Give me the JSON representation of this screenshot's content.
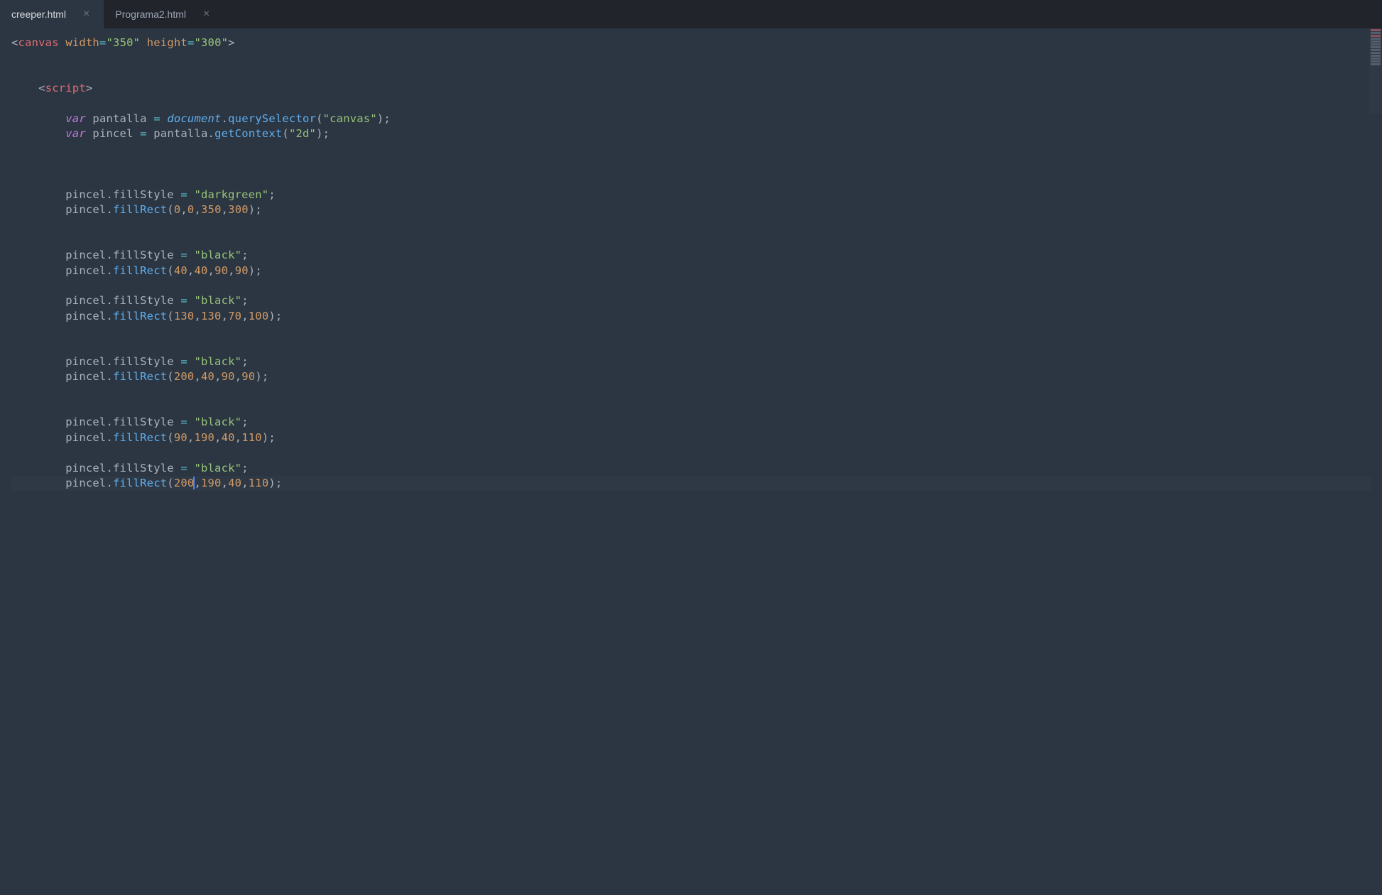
{
  "tabs": [
    {
      "label": "creeper.html",
      "active": true
    },
    {
      "label": "Programa2.html",
      "active": false
    }
  ],
  "code": {
    "lines": [
      {
        "type": "html",
        "indent": 0,
        "tokens": [
          {
            "t": "tag-bracket",
            "v": "<"
          },
          {
            "t": "tag-name",
            "v": "canvas"
          },
          {
            "t": "punct",
            "v": " "
          },
          {
            "t": "attr-name",
            "v": "width"
          },
          {
            "t": "operator",
            "v": "="
          },
          {
            "t": "attr-value",
            "v": "\"350\""
          },
          {
            "t": "punct",
            "v": " "
          },
          {
            "t": "attr-name",
            "v": "height"
          },
          {
            "t": "operator",
            "v": "="
          },
          {
            "t": "attr-value",
            "v": "\"300\""
          },
          {
            "t": "tag-bracket",
            "v": ">"
          }
        ]
      },
      {
        "type": "blank",
        "indent": 1
      },
      {
        "type": "blank",
        "indent": 1
      },
      {
        "type": "html",
        "indent": 1,
        "tokens": [
          {
            "t": "tag-bracket",
            "v": "<"
          },
          {
            "t": "tag-name",
            "v": "script"
          },
          {
            "t": "tag-bracket",
            "v": ">"
          }
        ]
      },
      {
        "type": "blank",
        "indent": 2
      },
      {
        "type": "js",
        "indent": 2,
        "tokens": [
          {
            "t": "keyword",
            "v": "var"
          },
          {
            "t": "punct",
            "v": " "
          },
          {
            "t": "variable",
            "v": "pantalla"
          },
          {
            "t": "punct",
            "v": " "
          },
          {
            "t": "operator",
            "v": "="
          },
          {
            "t": "punct",
            "v": " "
          },
          {
            "t": "builtin",
            "v": "document"
          },
          {
            "t": "dot",
            "v": "."
          },
          {
            "t": "method",
            "v": "querySelector"
          },
          {
            "t": "paren",
            "v": "("
          },
          {
            "t": "string",
            "v": "\"canvas\""
          },
          {
            "t": "paren",
            "v": ")"
          },
          {
            "t": "semi",
            "v": ";"
          }
        ]
      },
      {
        "type": "js",
        "indent": 2,
        "tokens": [
          {
            "t": "keyword",
            "v": "var"
          },
          {
            "t": "punct",
            "v": " "
          },
          {
            "t": "variable",
            "v": "pincel"
          },
          {
            "t": "punct",
            "v": " "
          },
          {
            "t": "operator",
            "v": "="
          },
          {
            "t": "punct",
            "v": " "
          },
          {
            "t": "variable",
            "v": "pantalla"
          },
          {
            "t": "dot",
            "v": "."
          },
          {
            "t": "method",
            "v": "getContext"
          },
          {
            "t": "paren",
            "v": "("
          },
          {
            "t": "string",
            "v": "\"2d\""
          },
          {
            "t": "paren",
            "v": ")"
          },
          {
            "t": "semi",
            "v": ";"
          }
        ]
      },
      {
        "type": "blank",
        "indent": 2
      },
      {
        "type": "blank",
        "indent": 2
      },
      {
        "type": "blank",
        "indent": 2
      },
      {
        "type": "js",
        "indent": 2,
        "tokens": [
          {
            "t": "variable",
            "v": "pincel"
          },
          {
            "t": "dot",
            "v": "."
          },
          {
            "t": "variable",
            "v": "fillStyle"
          },
          {
            "t": "punct",
            "v": " "
          },
          {
            "t": "operator",
            "v": "="
          },
          {
            "t": "punct",
            "v": " "
          },
          {
            "t": "string",
            "v": "\"darkgreen\""
          },
          {
            "t": "semi",
            "v": ";"
          }
        ]
      },
      {
        "type": "js",
        "indent": 2,
        "tokens": [
          {
            "t": "variable",
            "v": "pincel"
          },
          {
            "t": "dot",
            "v": "."
          },
          {
            "t": "method",
            "v": "fillRect"
          },
          {
            "t": "paren",
            "v": "("
          },
          {
            "t": "number",
            "v": "0"
          },
          {
            "t": "punct",
            "v": ","
          },
          {
            "t": "number",
            "v": "0"
          },
          {
            "t": "punct",
            "v": ","
          },
          {
            "t": "number",
            "v": "350"
          },
          {
            "t": "punct",
            "v": ","
          },
          {
            "t": "number",
            "v": "300"
          },
          {
            "t": "paren",
            "v": ")"
          },
          {
            "t": "semi",
            "v": ";"
          }
        ]
      },
      {
        "type": "blank",
        "indent": 2
      },
      {
        "type": "blank",
        "indent": 2
      },
      {
        "type": "js",
        "indent": 2,
        "tokens": [
          {
            "t": "variable",
            "v": "pincel"
          },
          {
            "t": "dot",
            "v": "."
          },
          {
            "t": "variable",
            "v": "fillStyle"
          },
          {
            "t": "punct",
            "v": " "
          },
          {
            "t": "operator",
            "v": "="
          },
          {
            "t": "punct",
            "v": " "
          },
          {
            "t": "string",
            "v": "\"black\""
          },
          {
            "t": "semi",
            "v": ";"
          }
        ]
      },
      {
        "type": "js",
        "indent": 2,
        "tokens": [
          {
            "t": "variable",
            "v": "pincel"
          },
          {
            "t": "dot",
            "v": "."
          },
          {
            "t": "method",
            "v": "fillRect"
          },
          {
            "t": "paren",
            "v": "("
          },
          {
            "t": "number",
            "v": "40"
          },
          {
            "t": "punct",
            "v": ","
          },
          {
            "t": "number",
            "v": "40"
          },
          {
            "t": "punct",
            "v": ","
          },
          {
            "t": "number",
            "v": "90"
          },
          {
            "t": "punct",
            "v": ","
          },
          {
            "t": "number",
            "v": "90"
          },
          {
            "t": "paren",
            "v": ")"
          },
          {
            "t": "semi",
            "v": ";"
          }
        ]
      },
      {
        "type": "blank",
        "indent": 2
      },
      {
        "type": "js",
        "indent": 2,
        "tokens": [
          {
            "t": "variable",
            "v": "pincel"
          },
          {
            "t": "dot",
            "v": "."
          },
          {
            "t": "variable",
            "v": "fillStyle"
          },
          {
            "t": "punct",
            "v": " "
          },
          {
            "t": "operator",
            "v": "="
          },
          {
            "t": "punct",
            "v": " "
          },
          {
            "t": "string",
            "v": "\"black\""
          },
          {
            "t": "semi",
            "v": ";"
          }
        ]
      },
      {
        "type": "js",
        "indent": 2,
        "tokens": [
          {
            "t": "variable",
            "v": "pincel"
          },
          {
            "t": "dot",
            "v": "."
          },
          {
            "t": "method",
            "v": "fillRect"
          },
          {
            "t": "paren",
            "v": "("
          },
          {
            "t": "number",
            "v": "130"
          },
          {
            "t": "punct",
            "v": ","
          },
          {
            "t": "number",
            "v": "130"
          },
          {
            "t": "punct",
            "v": ","
          },
          {
            "t": "number",
            "v": "70"
          },
          {
            "t": "punct",
            "v": ","
          },
          {
            "t": "number",
            "v": "100"
          },
          {
            "t": "paren",
            "v": ")"
          },
          {
            "t": "semi",
            "v": ";"
          }
        ]
      },
      {
        "type": "blank",
        "indent": 2
      },
      {
        "type": "blank",
        "indent": 2
      },
      {
        "type": "js",
        "indent": 2,
        "tokens": [
          {
            "t": "variable",
            "v": "pincel"
          },
          {
            "t": "dot",
            "v": "."
          },
          {
            "t": "variable",
            "v": "fillStyle"
          },
          {
            "t": "punct",
            "v": " "
          },
          {
            "t": "operator",
            "v": "="
          },
          {
            "t": "punct",
            "v": " "
          },
          {
            "t": "string",
            "v": "\"black\""
          },
          {
            "t": "semi",
            "v": ";"
          }
        ]
      },
      {
        "type": "js",
        "indent": 2,
        "tokens": [
          {
            "t": "variable",
            "v": "pincel"
          },
          {
            "t": "dot",
            "v": "."
          },
          {
            "t": "method",
            "v": "fillRect"
          },
          {
            "t": "paren",
            "v": "("
          },
          {
            "t": "number",
            "v": "200"
          },
          {
            "t": "punct",
            "v": ","
          },
          {
            "t": "number",
            "v": "40"
          },
          {
            "t": "punct",
            "v": ","
          },
          {
            "t": "number",
            "v": "90"
          },
          {
            "t": "punct",
            "v": ","
          },
          {
            "t": "number",
            "v": "90"
          },
          {
            "t": "paren",
            "v": ")"
          },
          {
            "t": "semi",
            "v": ";"
          }
        ]
      },
      {
        "type": "blank",
        "indent": 2
      },
      {
        "type": "blank",
        "indent": 2
      },
      {
        "type": "js",
        "indent": 2,
        "tokens": [
          {
            "t": "variable",
            "v": "pincel"
          },
          {
            "t": "dot",
            "v": "."
          },
          {
            "t": "variable",
            "v": "fillStyle"
          },
          {
            "t": "punct",
            "v": " "
          },
          {
            "t": "operator",
            "v": "="
          },
          {
            "t": "punct",
            "v": " "
          },
          {
            "t": "string",
            "v": "\"black\""
          },
          {
            "t": "semi",
            "v": ";"
          }
        ]
      },
      {
        "type": "js",
        "indent": 2,
        "tokens": [
          {
            "t": "variable",
            "v": "pincel"
          },
          {
            "t": "dot",
            "v": "."
          },
          {
            "t": "method",
            "v": "fillRect"
          },
          {
            "t": "paren",
            "v": "("
          },
          {
            "t": "number",
            "v": "90"
          },
          {
            "t": "punct",
            "v": ","
          },
          {
            "t": "number",
            "v": "190"
          },
          {
            "t": "punct",
            "v": ","
          },
          {
            "t": "number",
            "v": "40"
          },
          {
            "t": "punct",
            "v": ","
          },
          {
            "t": "number",
            "v": "110"
          },
          {
            "t": "paren",
            "v": ")"
          },
          {
            "t": "semi",
            "v": ";"
          }
        ]
      },
      {
        "type": "blank",
        "indent": 2
      },
      {
        "type": "js",
        "indent": 2,
        "tokens": [
          {
            "t": "variable",
            "v": "pincel"
          },
          {
            "t": "dot",
            "v": "."
          },
          {
            "t": "variable",
            "v": "fillStyle"
          },
          {
            "t": "punct",
            "v": " "
          },
          {
            "t": "operator",
            "v": "="
          },
          {
            "t": "punct",
            "v": " "
          },
          {
            "t": "string",
            "v": "\"black\""
          },
          {
            "t": "semi",
            "v": ";"
          }
        ]
      },
      {
        "type": "js",
        "indent": 2,
        "cursor_after_token": 5,
        "tokens": [
          {
            "t": "variable",
            "v": "pincel"
          },
          {
            "t": "dot",
            "v": "."
          },
          {
            "t": "method",
            "v": "fillRect"
          },
          {
            "t": "paren",
            "v": "("
          },
          {
            "t": "number",
            "v": "200"
          },
          {
            "t": "punct",
            "v": ","
          },
          {
            "t": "number",
            "v": "190"
          },
          {
            "t": "punct",
            "v": ","
          },
          {
            "t": "number",
            "v": "40"
          },
          {
            "t": "punct",
            "v": ","
          },
          {
            "t": "number",
            "v": "110"
          },
          {
            "t": "paren",
            "v": ")"
          },
          {
            "t": "semi",
            "v": ";"
          }
        ]
      }
    ]
  }
}
